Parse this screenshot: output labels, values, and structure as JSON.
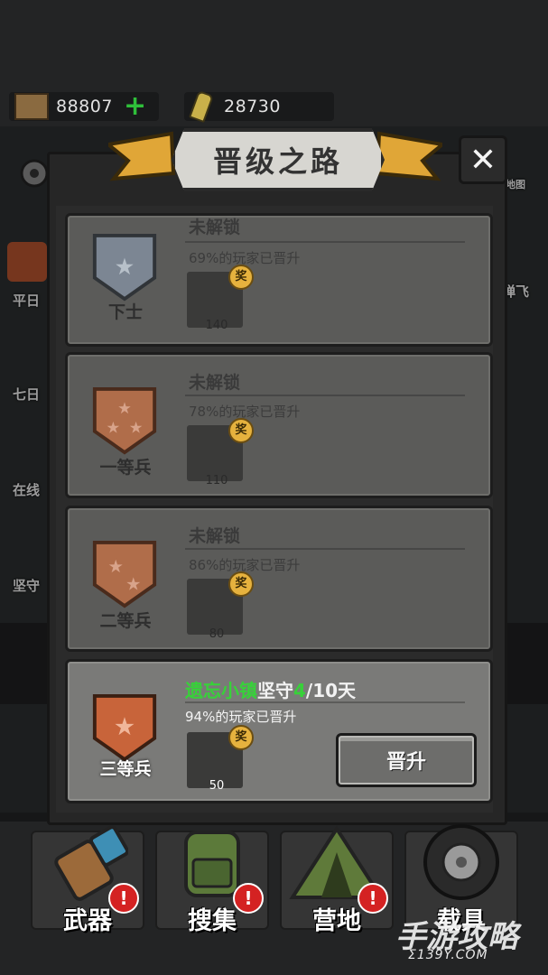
{
  "resources": {
    "wood": {
      "value": "88807",
      "icon": "wood-crate-icon"
    },
    "ammo": {
      "value": "28730",
      "icon": "ammo-shell-icon"
    }
  },
  "popup": {
    "title": "晋级之路",
    "close_icon": "close-icon",
    "ranks": [
      {
        "name": "下士",
        "status": "未解锁",
        "progress": "69%的玩家已晋升",
        "reward_count": "140",
        "reward_badge": "奖",
        "stars": 1,
        "shield_color": "#7c8693"
      },
      {
        "name": "一等兵",
        "status": "未解锁",
        "progress": "78%的玩家已晋升",
        "reward_count": "110",
        "reward_badge": "奖",
        "stars": 3,
        "shield_color": "#b06d4a"
      },
      {
        "name": "二等兵",
        "status": "未解锁",
        "progress": "86%的玩家已晋升",
        "reward_count": "80",
        "reward_badge": "奖",
        "stars": 2,
        "shield_color": "#b06d4a"
      },
      {
        "name": "三等兵",
        "progress": "94%的玩家已晋升",
        "reward_count": "50",
        "reward_badge": "奖",
        "stars": 1,
        "shield_color": "#c8643a",
        "requirement": {
          "place": "遗忘小镇",
          "action": "坚守",
          "current": "4",
          "target": "/10天"
        }
      }
    ],
    "promote_label": "晋升"
  },
  "background": {
    "side_labels": [
      "平日",
      "七日",
      "在线",
      "坚守"
    ],
    "right_labels": [
      "地图",
      "弹飞"
    ]
  },
  "nav": [
    {
      "label": "武器",
      "icon": "cannon-icon",
      "alert": "!"
    },
    {
      "label": "搜集",
      "icon": "backpack-icon",
      "alert": "!"
    },
    {
      "label": "营地",
      "icon": "tent-icon",
      "alert": "!"
    },
    {
      "label": "载具",
      "icon": "tire-icon"
    }
  ],
  "watermark": {
    "text": "手游攻略",
    "sub": "Σ139Y.COM"
  },
  "colors": {
    "accent_green": "#37d239",
    "ribbon": "#e0a637",
    "alert_red": "#d42222"
  }
}
